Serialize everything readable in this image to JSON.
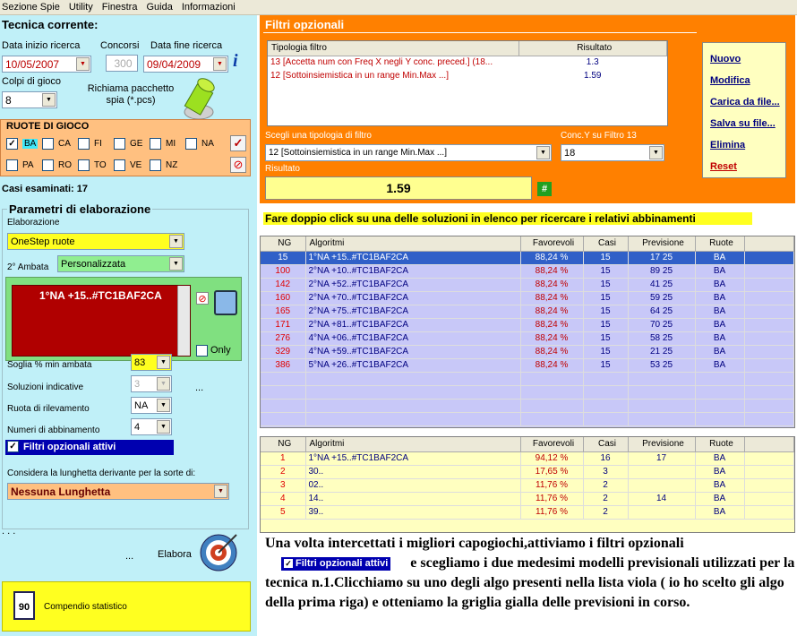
{
  "menu": [
    "Sezione Spie",
    "Utility",
    "Finestra",
    "Guida",
    "Informazioni"
  ],
  "left": {
    "title": "Tecnica corrente:",
    "date_start_label": "Data inizio ricerca",
    "date_start": "10/05/2007",
    "concorsi_label": "Concorsi",
    "concorsi": "300",
    "date_end_label": "Data fine ricerca",
    "date_end": "09/04/2009",
    "colpi_label": "Colpi di gioco",
    "colpi": "8",
    "richiama_label": "Richiama pacchetto spia (*.pcs)",
    "ruote_title": "RUOTE DI GIOCO",
    "ruote_row1": [
      "BA",
      "CA",
      "FI",
      "GE",
      "MI",
      "NA"
    ],
    "ruote_row2": [
      "PA",
      "RO",
      "TO",
      "VE",
      "NZ"
    ],
    "casi": "Casi esaminati: 17",
    "params_title": "Parametri di elaborazione",
    "elaborazione_label": "Elaborazione",
    "elaborazione": "OneStep ruote",
    "ambata_label": "2° Ambata",
    "ambata": "Personalizzata",
    "formula": "1°NA +15..#TC1BAF2CA",
    "only_label": "Only",
    "soglia_label": "Soglia % min ambata",
    "soglia": "83",
    "soluzioni_label": "Soluzioni indicative",
    "soluzioni": "3",
    "dots": "...",
    "ruota_ril_label": "Ruota di rilevamento",
    "ruota_ril": "NA",
    "numeri_label": "Numeri di abbinamento",
    "numeri": "4",
    "filtri_label": "Filtri opzionali attivi",
    "lunghetta_label": "Considera la lunghetta derivante per la sorte di:",
    "lunghetta": "Nessuna Lunghetta",
    "dots2": ". . .",
    "dots3": "...",
    "elabora": "Elabora",
    "compendio_num": "90",
    "compendio": "Compendio statistico"
  },
  "filtri": {
    "title": "Filtri opzionali",
    "cols": [
      "Tipologia filtro",
      "Risultato"
    ],
    "rows": [
      [
        "13 [Accetta num con Freq X negli Y conc. preced.] (18...",
        "1.3"
      ],
      [
        "12 [Sottoinsiemistica in un range Min.Max ...]",
        "1.59"
      ]
    ],
    "scegli_label": "Scegli una tipologia di filtro",
    "scegli": "12 [Sottoinsiemistica in un range Min.Max ...]",
    "conc_label": "Conc.Y su Filtro 13",
    "conc": "18",
    "risultato_label": "Risultato",
    "risultato": "1.59",
    "hash": "#",
    "buttons": [
      "Nuovo",
      "Modifica",
      "Carica da file...",
      "Salva su file...",
      "Elimina",
      "Reset"
    ]
  },
  "hint": "Fare doppio click su una delle soluzioni in elenco per ricercare i relativi abbinamenti",
  "grid1": {
    "cols": [
      "NG",
      "Algoritmi",
      "Favorevoli",
      "Casi",
      "Previsione",
      "Ruote"
    ],
    "rows": [
      [
        "15",
        "1°NA +15..#TC1BAF2CA",
        "88,24 %",
        "15",
        "17 25",
        "BA"
      ],
      [
        "100",
        "2°NA +10..#TC1BAF2CA",
        "88,24 %",
        "15",
        "89 25",
        "BA"
      ],
      [
        "142",
        "2°NA +52..#TC1BAF2CA",
        "88,24 %",
        "15",
        "41 25",
        "BA"
      ],
      [
        "160",
        "2°NA +70..#TC1BAF2CA",
        "88,24 %",
        "15",
        "59 25",
        "BA"
      ],
      [
        "165",
        "2°NA +75..#TC1BAF2CA",
        "88,24 %",
        "15",
        "64 25",
        "BA"
      ],
      [
        "171",
        "2°NA +81..#TC1BAF2CA",
        "88,24 %",
        "15",
        "70 25",
        "BA"
      ],
      [
        "276",
        "4°NA +06..#TC1BAF2CA",
        "88,24 %",
        "15",
        "58 25",
        "BA"
      ],
      [
        "329",
        "4°NA +59..#TC1BAF2CA",
        "88,24 %",
        "15",
        "21 25",
        "BA"
      ],
      [
        "386",
        "5°NA +26..#TC1BAF2CA",
        "88,24 %",
        "15",
        "53 25",
        "BA"
      ]
    ]
  },
  "grid2": {
    "cols": [
      "NG",
      "Algoritmi",
      "Favorevoli",
      "Casi",
      "Previsione",
      "Ruote"
    ],
    "rows": [
      [
        "1",
        "1°NA +15..#TC1BAF2CA",
        "94,12 %",
        "16",
        "17",
        "BA"
      ],
      [
        "2",
        "30..",
        "17,65 %",
        "3",
        "",
        "BA"
      ],
      [
        "3",
        "02..",
        "11,76 %",
        "2",
        "",
        "BA"
      ],
      [
        "4",
        "14..",
        "11,76 %",
        "2",
        "14",
        "BA"
      ],
      [
        "5",
        "39..",
        "11,76 %",
        "2",
        "",
        "BA"
      ]
    ]
  },
  "caption": {
    "p1": "Una volta intercettati i migliori capogiochi,attiviamo i filtri opzionali",
    "badge": "Filtri opzionali attivi",
    "p2": "e scegliamo i due medesimi modelli previsionali utilizzati per la tecnica n.1.Clicchiamo su uno degli algo presenti nella lista viola ( io ho scelto gli algo della prima riga) e otteniamo la griglia gialla delle previsioni in corso."
  }
}
